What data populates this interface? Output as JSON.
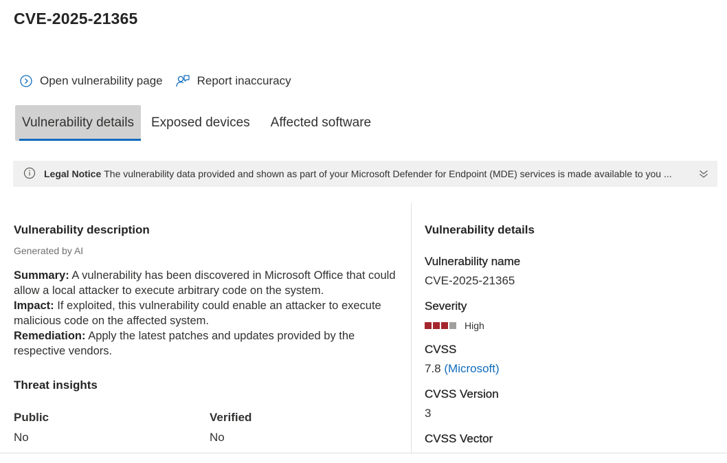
{
  "page": {
    "title": "CVE-2025-21365"
  },
  "actions": {
    "open_page": "Open vulnerability page",
    "report": "Report inaccuracy"
  },
  "tabs": [
    {
      "label": "Vulnerability details",
      "active": true
    },
    {
      "label": "Exposed devices",
      "active": false
    },
    {
      "label": "Affected software",
      "active": false
    }
  ],
  "notice": {
    "bold": "Legal Notice",
    "text": "The vulnerability data provided and shown as part of your Microsoft Defender for Endpoint (MDE) services is made available to you ..."
  },
  "description": {
    "title": "Vulnerability description",
    "generated": "Generated by AI",
    "summary_label": "Summary:",
    "summary": "A vulnerability has been discovered in Microsoft Office that could allow a local attacker to execute arbitrary code on the system.",
    "impact_label": "Impact:",
    "impact": "If exploited, this vulnerability could enable an attacker to execute malicious code on the affected system.",
    "remediation_label": "Remediation:",
    "remediation": "Apply the latest patches and updates provided by the respective vendors."
  },
  "threat": {
    "title": "Threat insights",
    "public_label": "Public",
    "public_value": "No",
    "verified_label": "Verified",
    "verified_value": "No"
  },
  "details": {
    "title": "Vulnerability details",
    "name_label": "Vulnerability name",
    "name_value": "CVE-2025-21365",
    "severity_label": "Severity",
    "severity_value": "High",
    "severity_level": 3,
    "severity_max": 4,
    "cvss_label": "CVSS",
    "cvss_value": "7.8",
    "cvss_source": "(Microsoft)",
    "cvss_version_label": "CVSS Version",
    "cvss_version_value": "3",
    "cvss_vector_label": "CVSS Vector"
  },
  "colors": {
    "accent": "#0f6cbd",
    "severity_high": "#a4262c",
    "severity_off": "#a19f9d"
  }
}
